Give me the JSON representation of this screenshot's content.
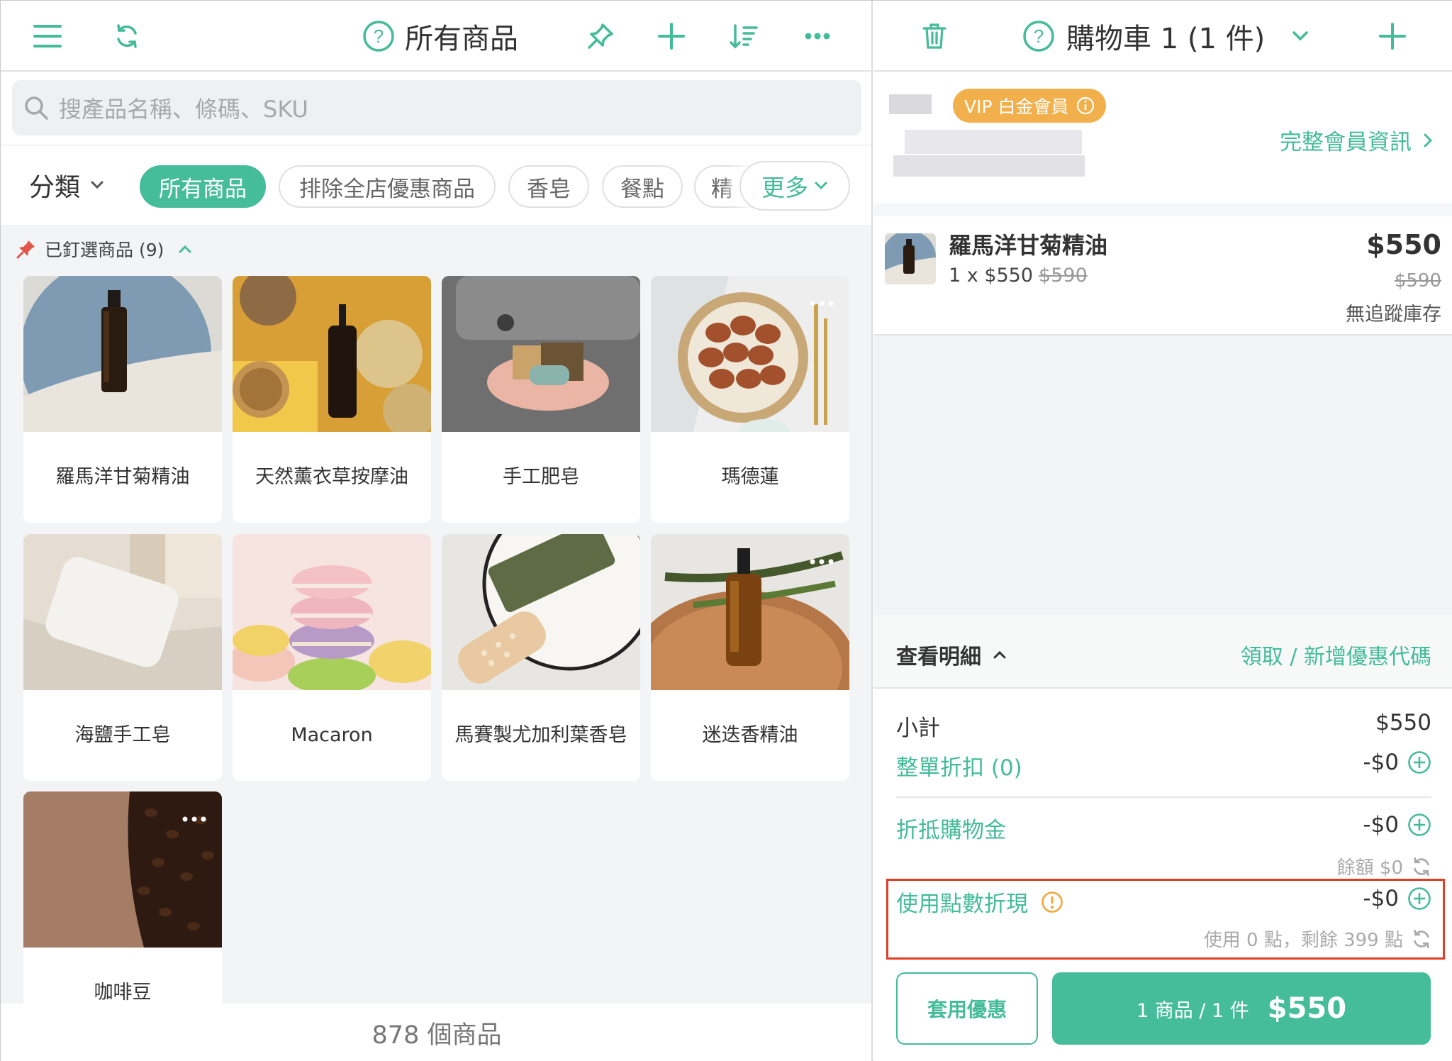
{
  "left_header": {
    "title": "所有商品"
  },
  "search": {
    "placeholder": "搜產品名稱、條碼、SKU"
  },
  "filters": {
    "category_label": "分類",
    "chips": [
      "所有商品",
      "排除全店優惠商品",
      "香皂",
      "餐點",
      "精"
    ],
    "more_label": "更多"
  },
  "pinned": {
    "label": "已釘選商品 (9)"
  },
  "products": [
    {
      "name": "羅馬洋甘菊精油",
      "image": "essential-oil-on-plate"
    },
    {
      "name": "天然薰衣草按摩油",
      "image": "massage-oil-with-loofah"
    },
    {
      "name": "手工肥皂",
      "image": "soap-stack-on-shell-dish"
    },
    {
      "name": "瑪德蓮",
      "image": "madeleines-in-basket"
    },
    {
      "name": "海鹽手工皂",
      "image": "white-sea-salt-soap"
    },
    {
      "name": "Macaron",
      "image": "macaron-stack"
    },
    {
      "name": "馬賽製尤加利葉香皂",
      "image": "green-marseille-soap"
    },
    {
      "name": "迷迭香精油",
      "image": "dropper-bottle-on-wood"
    },
    {
      "name": "咖啡豆",
      "image": "coffee-beans"
    }
  ],
  "product_count": "878 個商品",
  "cart_header": {
    "title": "購物車 1 (1 件)"
  },
  "member": {
    "badge": "VIP 白金會員",
    "link": "完整會員資訊"
  },
  "cart_item": {
    "name": "羅馬洋甘菊精油",
    "qty_price": "1 x $550",
    "qty_original": "$590",
    "price": "$550",
    "original_price": "$590",
    "stock": "無追蹤庫存"
  },
  "details": {
    "toggle": "查看明細",
    "coupon_link": "領取 / 新增優惠代碼",
    "subtotal_label": "小計",
    "subtotal_value": "$550",
    "order_discount_label": "整單折扣 (0)",
    "order_discount_value": "-$0",
    "credit_label": "折抵購物金",
    "credit_value": "-$0",
    "credit_balance": "餘額 $0",
    "points_label": "使用點數折現",
    "points_value": "-$0",
    "points_info": "使用 0 點，剩餘 399 點"
  },
  "buttons": {
    "apply_discount": "套用優惠",
    "checkout_count": "1 商品 / 1 件",
    "checkout_total": "$550"
  },
  "colors": {
    "accent": "#46bd9a",
    "vip": "#f1b04b",
    "highlight": "#e23d25",
    "pin": "#e0574a"
  }
}
